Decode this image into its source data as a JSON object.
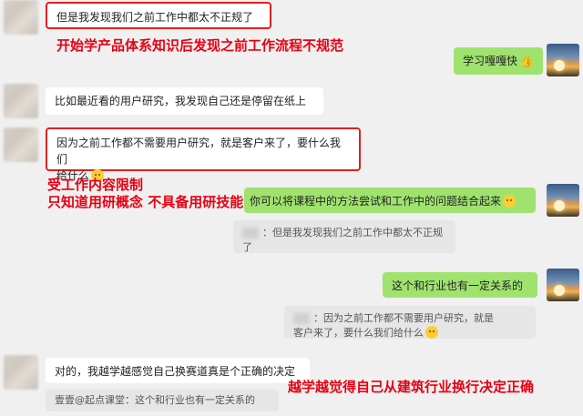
{
  "messages": {
    "m1": "但是我发现我们之前工作中都太不正规了",
    "m2": "学习嘎嘎快",
    "m3": "比如最近看的用户研究，我发现自己还是停留在纸上",
    "m4_line1": "因为之前工作都不需要用户研究，就是客户来了，要什么我们",
    "m4_line2": "给什么",
    "m5": "你可以将课程中的方法尝试和工作中的问题结合起来",
    "q5_line1": "：但是我发现我们之前工作中都太不正规",
    "q5_line2": "了",
    "m6": "这个和行业也有一定关系的",
    "q6_line1": "：因为之前工作都不需要用户研究，就是",
    "q6_line2": "客户来了，要什么我们给什么",
    "m7": "对的，我越学越感觉自己换赛道真是个正确的决定",
    "q7": "壹壹@起点课堂：这个和行业也有一定关系的"
  },
  "annotations": {
    "a1": "开始学产品体系知识后发现之前工作流程不规范",
    "a2_line1": "受工作内容限制",
    "a2_line2": "只知道用研概念  不具备用研技能",
    "a3": "越学越觉得自己从建筑行业换行决定正确"
  },
  "icons": {
    "emoji": "smiling-face-icon",
    "thumb": "thumbs-up-icon"
  },
  "colors": {
    "background": "#f0f0f0",
    "bubble_self": "#9fe36e",
    "bubble_other": "#ffffff",
    "annotation_red": "#e60012"
  }
}
